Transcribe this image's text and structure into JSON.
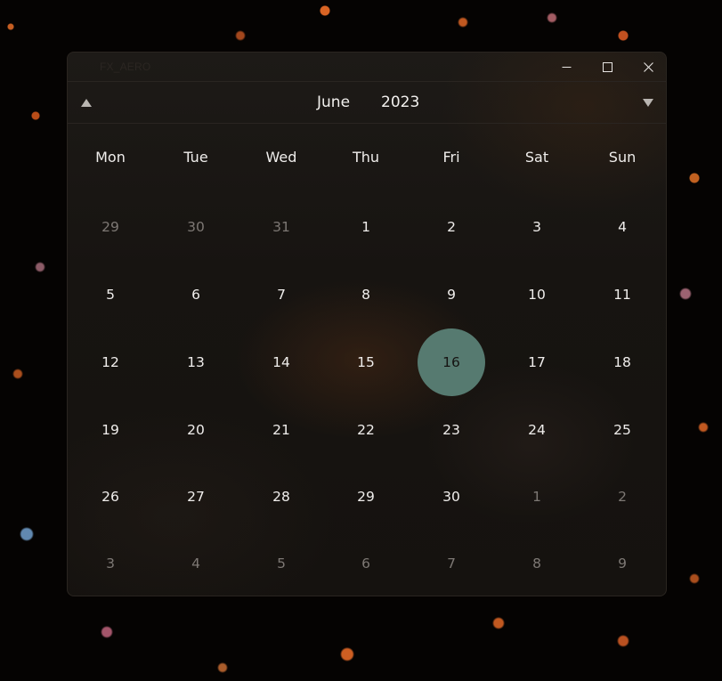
{
  "window": {
    "title": "FX_AERO",
    "controls": {
      "minimize_icon": "minimize-icon",
      "maximize_icon": "maximize-icon",
      "close_icon": "close-icon"
    }
  },
  "calendar": {
    "month": "June",
    "year": "2023",
    "prev_icon": "triangle-up-icon",
    "next_icon": "triangle-down-icon",
    "weekdays": [
      "Mon",
      "Tue",
      "Wed",
      "Thu",
      "Fri",
      "Sat",
      "Sun"
    ],
    "weeks": [
      [
        {
          "d": "29",
          "other": true
        },
        {
          "d": "30",
          "other": true
        },
        {
          "d": "31",
          "other": true
        },
        {
          "d": "1"
        },
        {
          "d": "2"
        },
        {
          "d": "3"
        },
        {
          "d": "4"
        }
      ],
      [
        {
          "d": "5"
        },
        {
          "d": "6"
        },
        {
          "d": "7"
        },
        {
          "d": "8"
        },
        {
          "d": "9"
        },
        {
          "d": "10"
        },
        {
          "d": "11"
        }
      ],
      [
        {
          "d": "12"
        },
        {
          "d": "13"
        },
        {
          "d": "14"
        },
        {
          "d": "15"
        },
        {
          "d": "16",
          "selected": true
        },
        {
          "d": "17"
        },
        {
          "d": "18"
        }
      ],
      [
        {
          "d": "19"
        },
        {
          "d": "20"
        },
        {
          "d": "21"
        },
        {
          "d": "22"
        },
        {
          "d": "23"
        },
        {
          "d": "24"
        },
        {
          "d": "25"
        }
      ],
      [
        {
          "d": "26"
        },
        {
          "d": "27"
        },
        {
          "d": "28"
        },
        {
          "d": "29"
        },
        {
          "d": "30"
        },
        {
          "d": "1",
          "other": true
        },
        {
          "d": "2",
          "other": true
        }
      ],
      [
        {
          "d": "3",
          "other": true
        },
        {
          "d": "4",
          "other": true
        },
        {
          "d": "5",
          "other": true
        },
        {
          "d": "6",
          "other": true
        },
        {
          "d": "7",
          "other": true
        },
        {
          "d": "8",
          "other": true
        },
        {
          "d": "9",
          "other": true
        }
      ]
    ],
    "selected_color": "#567a70",
    "other_month_color": "#7d7874"
  }
}
